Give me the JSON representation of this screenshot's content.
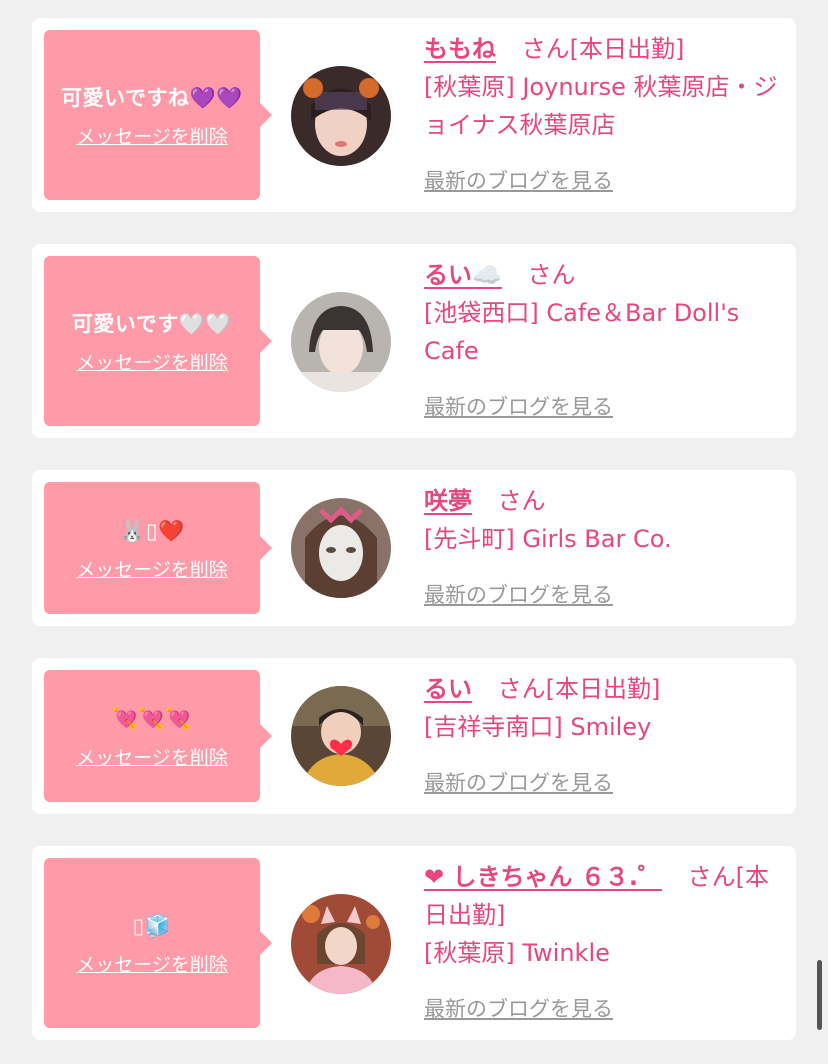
{
  "cards": [
    {
      "message": "可愛いですね💜💜",
      "delete_label": "メッセージを削除",
      "name": "ももね",
      "honorific": "さん[本日出勤]",
      "store": "[秋葉原] Joynurse 秋葉原店・ジョイナス秋葉原店",
      "blog_label": "最新のブログを見る"
    },
    {
      "message": "可愛いです🤍🤍",
      "delete_label": "メッセージを削除",
      "name": "るい☁️",
      "honorific": "さん",
      "store": "[池袋西口] Cafe＆Bar Doll's Cafe",
      "blog_label": "最新のブログを見る"
    },
    {
      "message": "🐰▯❤️",
      "delete_label": "メッセージを削除",
      "name": "咲夢",
      "honorific": "さん",
      "store": "[先斗町] Girls Bar Co.",
      "blog_label": "最新のブログを見る"
    },
    {
      "message": "💘💘💘",
      "delete_label": "メッセージを削除",
      "name": "るい",
      "honorific": "さん[本日出勤]",
      "store": "[吉祥寺南口] Smiley",
      "blog_label": "最新のブログを見る"
    },
    {
      "message": "▯🧊",
      "delete_label": "メッセージを削除",
      "name": "❤ しきちゃん ６３.゜",
      "honorific": "さん[本日出勤]",
      "store": "[秋葉原] Twinkle",
      "blog_label": "最新のブログを見る"
    }
  ],
  "colors": {
    "accent": "#e6477c",
    "bubble": "#ff9aa8",
    "link_gray": "#999999",
    "background": "#f0f0f0"
  }
}
